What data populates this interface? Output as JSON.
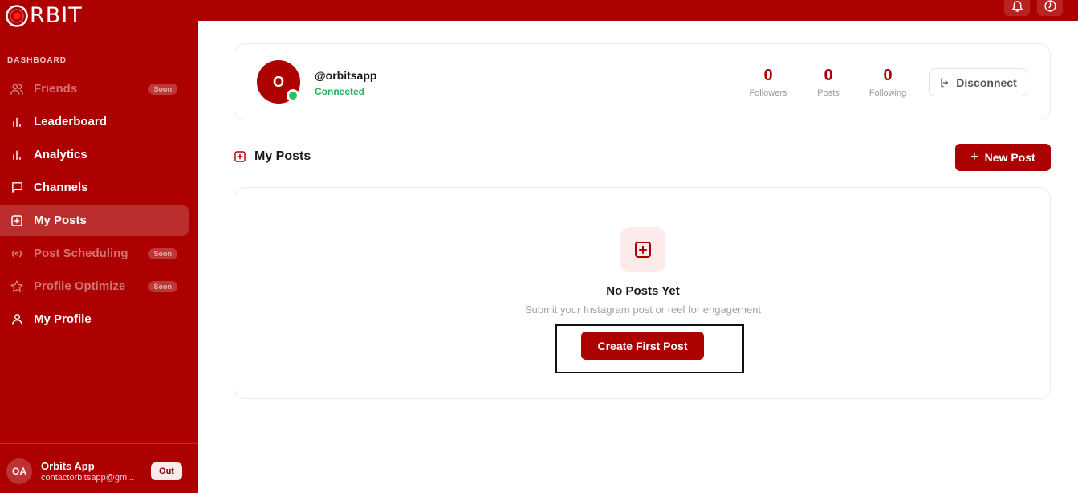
{
  "brand": {
    "logo_text": "RBIT",
    "accent": "#ad0000"
  },
  "sidebar": {
    "section_label": "DASHBOARD",
    "items": [
      {
        "label": "Friends",
        "icon": "users-icon",
        "badge": "Soon",
        "state": "disabled"
      },
      {
        "label": "Leaderboard",
        "icon": "bar-chart-icon",
        "state": "normal"
      },
      {
        "label": "Analytics",
        "icon": "bar-chart-icon",
        "state": "normal"
      },
      {
        "label": "Channels",
        "icon": "chat-bubble-icon",
        "state": "normal"
      },
      {
        "label": "My Posts",
        "icon": "plus-square-icon",
        "state": "active"
      },
      {
        "label": "Post Scheduling",
        "icon": "broadcast-icon",
        "badge": "Soon",
        "state": "disabled"
      },
      {
        "label": "Profile Optimize",
        "icon": "star-icon",
        "badge": "Soon",
        "state": "disabled"
      },
      {
        "label": "My Profile",
        "icon": "user-icon",
        "state": "normal"
      }
    ],
    "user": {
      "initials": "OA",
      "name": "Orbits App",
      "email": "contactorbitsapp@gm...",
      "logout_label": "Out"
    }
  },
  "topbar": {
    "icons": [
      "bell-icon",
      "clock-icon"
    ]
  },
  "profile": {
    "avatar_initial": "O",
    "handle": "@orbitsapp",
    "status": "Connected",
    "stats": [
      {
        "value": "0",
        "label": "Followers"
      },
      {
        "value": "0",
        "label": "Posts"
      },
      {
        "value": "0",
        "label": "Following"
      }
    ],
    "disconnect_label": "Disconnect"
  },
  "posts": {
    "title": "My Posts",
    "new_post_label": "New Post",
    "empty_title": "No Posts Yet",
    "empty_subtitle": "Submit your Instagram post or reel for engagement",
    "create_label": "Create First Post"
  }
}
